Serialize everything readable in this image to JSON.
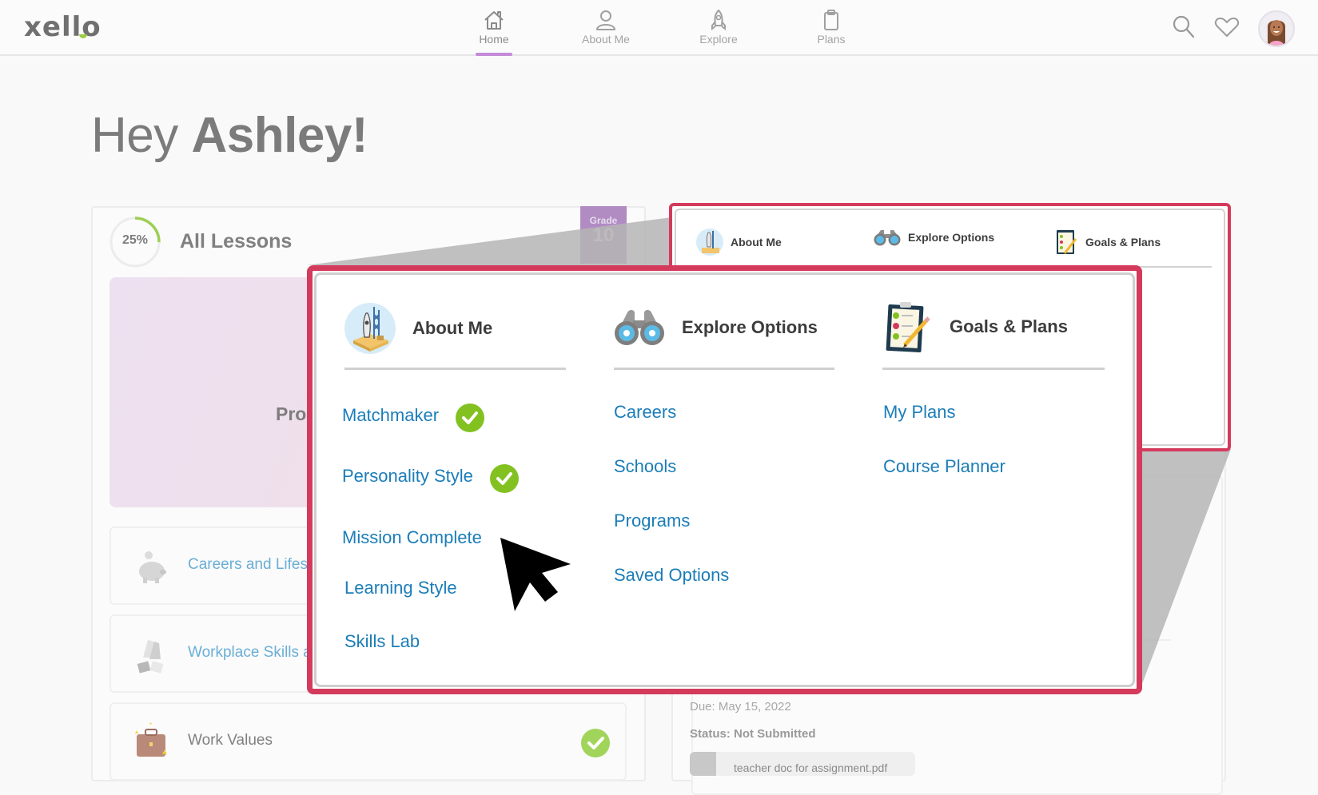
{
  "app": {
    "logo": "xello",
    "brand_accent": "#9acd43",
    "nav_active_underline": "#c48bd9"
  },
  "nav": {
    "items": [
      {
        "label": "Home",
        "icon": "home-icon",
        "active": true
      },
      {
        "label": "About Me",
        "icon": "user-icon",
        "active": false
      },
      {
        "label": "Explore",
        "icon": "rocket-icon",
        "active": false
      },
      {
        "label": "Plans",
        "icon": "clipboard-icon",
        "active": false
      }
    ],
    "right_icons": [
      "search-icon",
      "heart-icon",
      "avatar"
    ]
  },
  "greeting": {
    "prefix": "Hey",
    "name": "Ashley!"
  },
  "lessons_card": {
    "progress_percent": 25,
    "progress_label": "25%",
    "title": "All Lessons",
    "grade_label": "Grade",
    "grade_value": "10",
    "hero_text_partial": "Pro",
    "rows": [
      {
        "label": "Careers and Lifes",
        "icon": "piggy-bank-icon",
        "completed": false
      },
      {
        "label": "Workplace Skills a",
        "icon": "high-five-icon",
        "completed": false
      },
      {
        "label": "Work Values",
        "icon": "briefcase-icon",
        "completed": true
      }
    ]
  },
  "assignment_card": {
    "due": "Due: May 15, 2022",
    "status": "Status: Not Submitted",
    "attachment": "teacher doc for assignment.pdf"
  },
  "small_menu": {
    "columns": [
      {
        "title": "About Me",
        "icon": "rocket-launch-icon"
      },
      {
        "title": "Explore Options",
        "icon": "binoculars-icon"
      },
      {
        "title": "Goals & Plans",
        "icon": "checklist-icon"
      }
    ]
  },
  "mega_menu": {
    "highlight_color": "#d43a5c",
    "link_color": "#1b7db8",
    "check_color": "#83c121",
    "columns": [
      {
        "title": "About Me",
        "icon": "rocket-launch-icon",
        "links": [
          {
            "label": "Matchmaker",
            "completed": true
          },
          {
            "label": "Personality Style",
            "completed": true
          },
          {
            "label": "Mission Complete",
            "completed": false
          },
          {
            "label": "Learning Style",
            "completed": false
          },
          {
            "label": "Skills Lab",
            "completed": false
          }
        ]
      },
      {
        "title": "Explore Options",
        "icon": "binoculars-icon",
        "links": [
          {
            "label": "Careers"
          },
          {
            "label": "Schools"
          },
          {
            "label": "Programs"
          },
          {
            "label": "Saved Options"
          }
        ]
      },
      {
        "title": "Goals & Plans",
        "icon": "checklist-icon",
        "links": [
          {
            "label": "My Plans"
          },
          {
            "label": "Course Planner"
          }
        ]
      }
    ]
  }
}
